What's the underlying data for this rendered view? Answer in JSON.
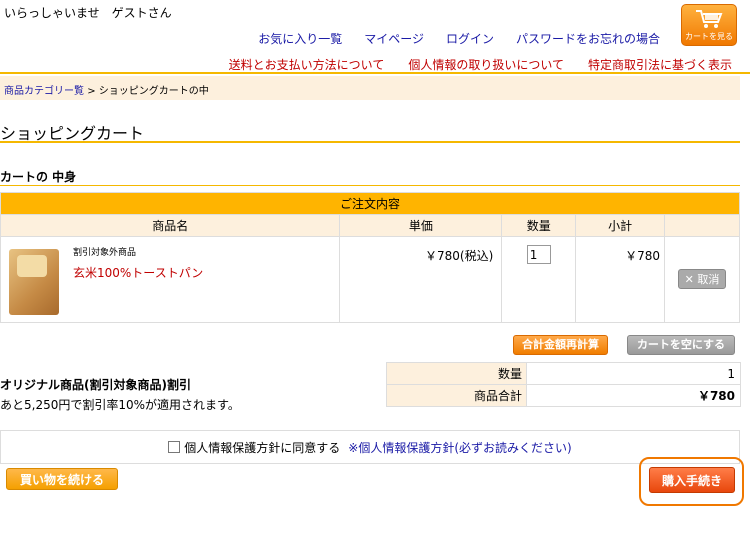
{
  "header": {
    "welcome": "いらっしゃいませ　ゲストさん",
    "links": [
      "お気に入り一覧",
      "マイページ",
      "ログイン",
      "パスワードをお忘れの場合"
    ],
    "cart_button_label": "カートを見る",
    "sublinks": [
      "送料とお支払い方法について",
      "個人情報の取り扱いについて",
      "特定商取引法に基づく表示"
    ]
  },
  "breadcrumb": {
    "link": "商品カテゴリー覧",
    "current": "> ショッピングカートの中"
  },
  "page_title": "ショッピングカート",
  "section_title": "カートの 中身",
  "cart_table": {
    "header": "ご注文内容",
    "columns": [
      "商品名",
      "単価",
      "数量",
      "小計"
    ],
    "item": {
      "category": "割引対象外商品",
      "name": "玄米100%トーストパン",
      "price": "￥780(税込)",
      "qty": "1",
      "subtotal": "￥780",
      "delete_label": "✕ 取消"
    }
  },
  "buttons": {
    "recalc": "合計金額再計算",
    "empty_cart": "カートを空にする",
    "continue": "買い物を続ける",
    "checkout": "購入手続き"
  },
  "discount": {
    "title": "オリジナル商品(割引対象商品)割引",
    "note": "あと5,250円で割引率10%が適用されます。"
  },
  "summary": {
    "qty_label": "数量",
    "qty_value": "1",
    "total_label": "商品合計",
    "total_value": "￥780"
  },
  "agreement": {
    "label": "個人情報保護方針に同意する",
    "link": "※個人情報保護方針(必ずお読みください)"
  },
  "colors": {
    "accent": "#f5b800",
    "orange": "#f07800",
    "link": "#1a1aa6",
    "red_link": "#c00000"
  }
}
